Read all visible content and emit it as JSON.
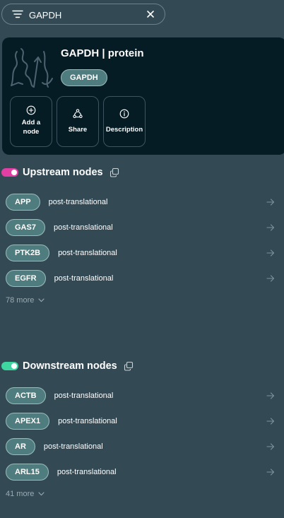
{
  "search": {
    "query": "GAPDH"
  },
  "entity": {
    "title": "GAPDH | protein",
    "tag": "GAPDH",
    "actions": [
      {
        "line1": "Add a",
        "line2": "node",
        "icon": "plus-circle-icon"
      },
      {
        "line1": "Share",
        "icon": "share-icon"
      },
      {
        "line1": "Description",
        "icon": "info-icon"
      }
    ]
  },
  "upstream": {
    "title": "Upstream nodes",
    "toggle_color": "#e23fa4",
    "items": [
      {
        "gene": "APP",
        "relation": "post-translational"
      },
      {
        "gene": "GAS7",
        "relation": "post-translational"
      },
      {
        "gene": "PTK2B",
        "relation": "post-translational"
      },
      {
        "gene": "EGFR",
        "relation": "post-translational"
      }
    ],
    "more": "78 more"
  },
  "downstream": {
    "title": "Downstream nodes",
    "toggle_color": "#3ed6a0",
    "items": [
      {
        "gene": "ACTB",
        "relation": "post-translational"
      },
      {
        "gene": "APEX1",
        "relation": "post-translational"
      },
      {
        "gene": "AR",
        "relation": "post-translational"
      },
      {
        "gene": "ARL15",
        "relation": "post-translational"
      }
    ],
    "more": "41 more"
  }
}
